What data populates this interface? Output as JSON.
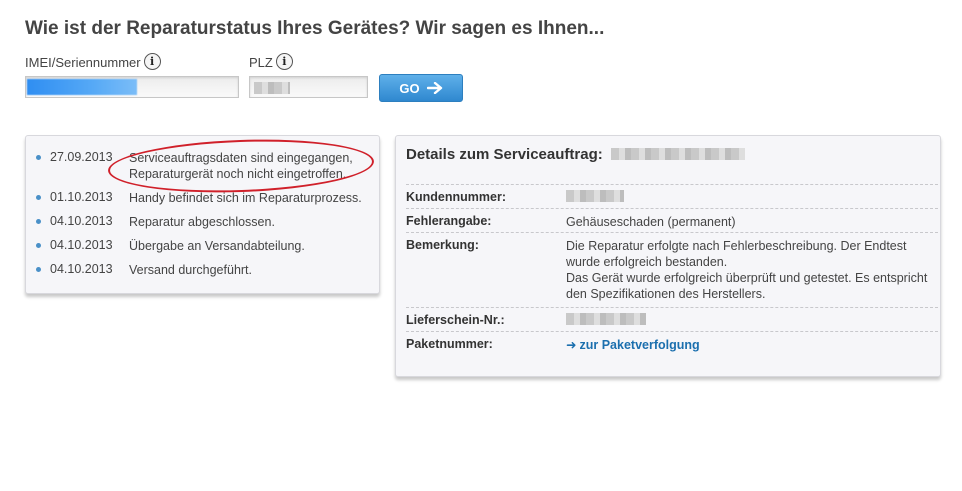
{
  "page": {
    "title": "Wie ist der Reparaturstatus Ihres Gerätes? Wir sagen es Ihnen..."
  },
  "form": {
    "imei_label": "IMEI/Seriennummer",
    "plz_label": "PLZ",
    "info_glyph": "i",
    "go_label": "GO"
  },
  "history": [
    {
      "date": "27.09.2013",
      "text": "Serviceauftragsdaten sind eingegangen, Reparaturgerät noch nicht eingetroffen."
    },
    {
      "date": "01.10.2013",
      "text": "Handy befindet sich im Reparaturprozess."
    },
    {
      "date": "04.10.2013",
      "text": "Reparatur abgeschlossen."
    },
    {
      "date": "04.10.2013",
      "text": "Übergabe an Versandabteilung."
    },
    {
      "date": "04.10.2013",
      "text": "Versand durchgeführt."
    }
  ],
  "details": {
    "title": "Details zum Serviceauftrag:",
    "rows": [
      {
        "key": "Kundennummer:",
        "value": ""
      },
      {
        "key": "Fehlerangabe:",
        "value": "Gehäuseschaden (permanent)"
      },
      {
        "key": "Bemerkung:",
        "value": "Die Reparatur erfolgte nach Fehlerbeschreibung. Der Endtest wurde erfolgreich bestanden.\nDas Gerät wurde erfolgreich überprüft und getestet. Es entspricht den Spezifikationen des Herstellers."
      },
      {
        "key": "Lieferschein-Nr.:",
        "value": ""
      },
      {
        "key": "Paketnummer:",
        "value": "zur Paketverfolgung"
      }
    ]
  },
  "colors": {
    "accent_blue": "#2f88cf",
    "annotation_red": "#d0202a",
    "bullet_blue": "#4a90c8"
  },
  "icons": {
    "info": "info-icon",
    "go_arrow": "arrow-right-icon",
    "link_arrow": "arrow-right-icon"
  }
}
